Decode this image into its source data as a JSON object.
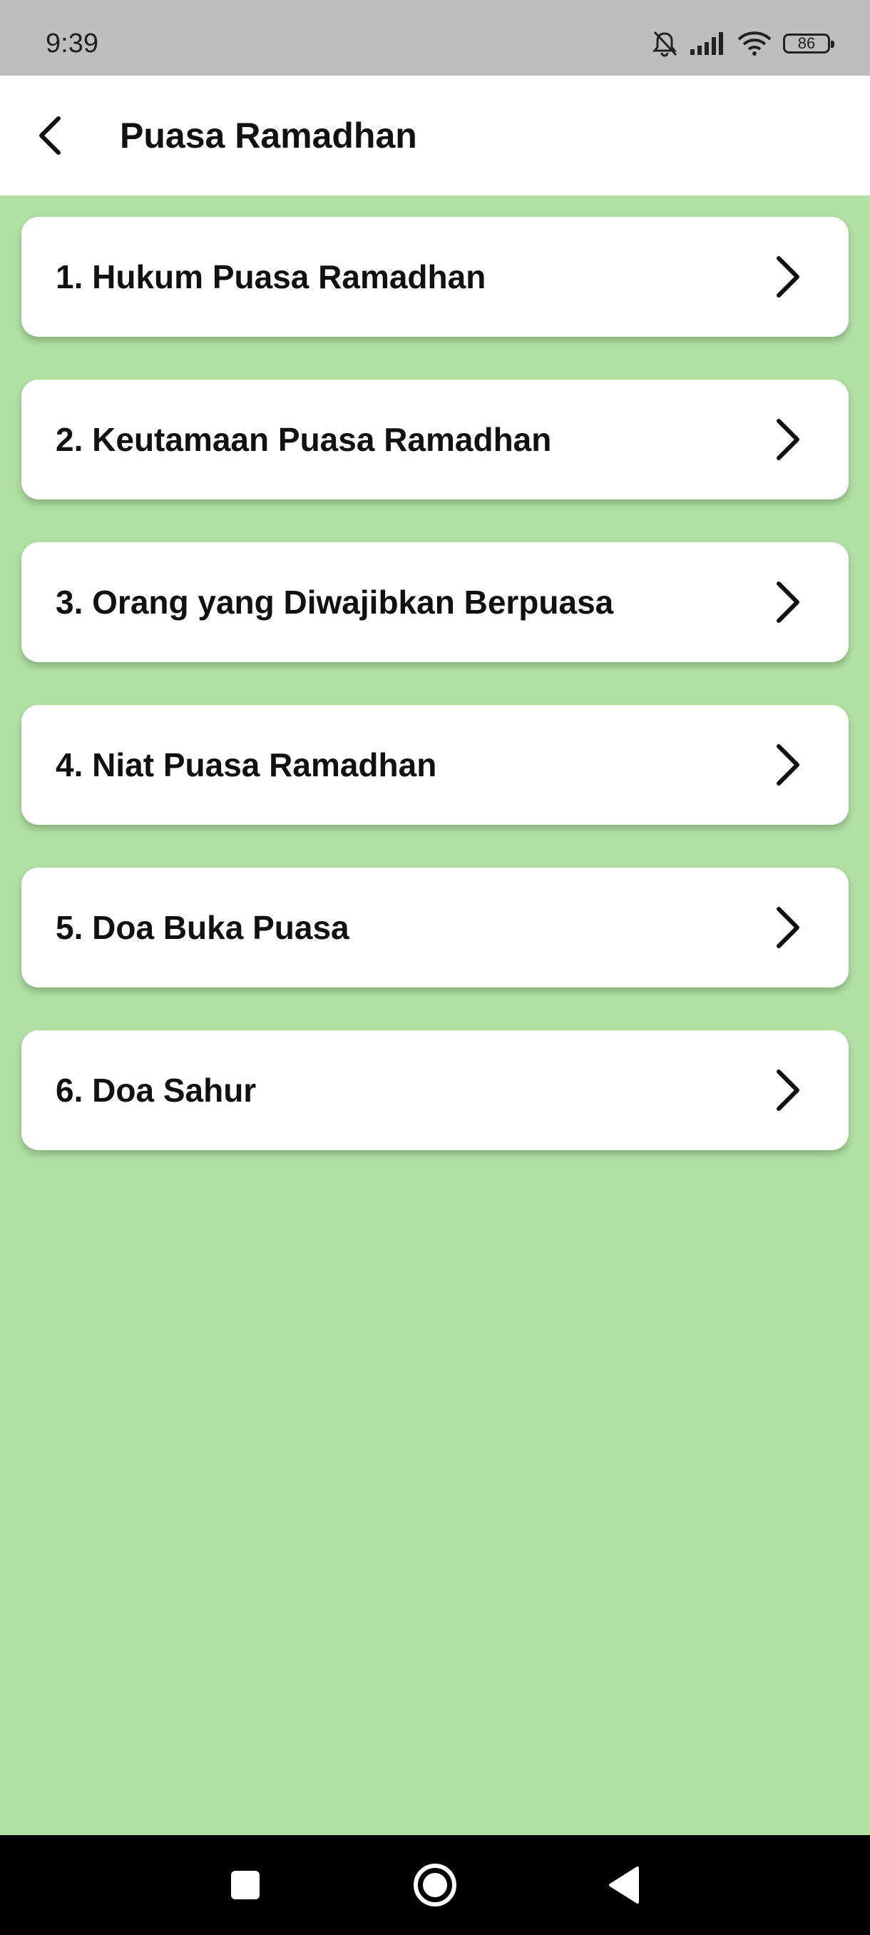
{
  "status_bar": {
    "time": "9:39",
    "battery": "86",
    "icons": [
      "bell-off-icon",
      "signal-icon",
      "wifi-icon",
      "battery-icon"
    ]
  },
  "app_bar": {
    "title": "Puasa Ramadhan",
    "back_icon": "back-arrow-icon"
  },
  "list": {
    "items": [
      {
        "label": "1. Hukum Puasa Ramadhan"
      },
      {
        "label": "2. Keutamaan Puasa Ramadhan"
      },
      {
        "label": "3. Orang yang Diwajibkan Berpuasa"
      },
      {
        "label": "4. Niat Puasa Ramadhan"
      },
      {
        "label": "5. Doa Buka Puasa"
      },
      {
        "label": "6. Doa Sahur"
      }
    ],
    "chevron_icon": "chevron-right-icon"
  },
  "nav_bar": {
    "buttons": [
      "recents-square-icon",
      "home-circle-icon",
      "back-triangle-icon"
    ]
  },
  "colors": {
    "background": "#b0e0a2",
    "status_bar": "#bebebe",
    "app_bar": "#ffffff",
    "card": "#ffffff",
    "nav_bar": "#000000"
  }
}
